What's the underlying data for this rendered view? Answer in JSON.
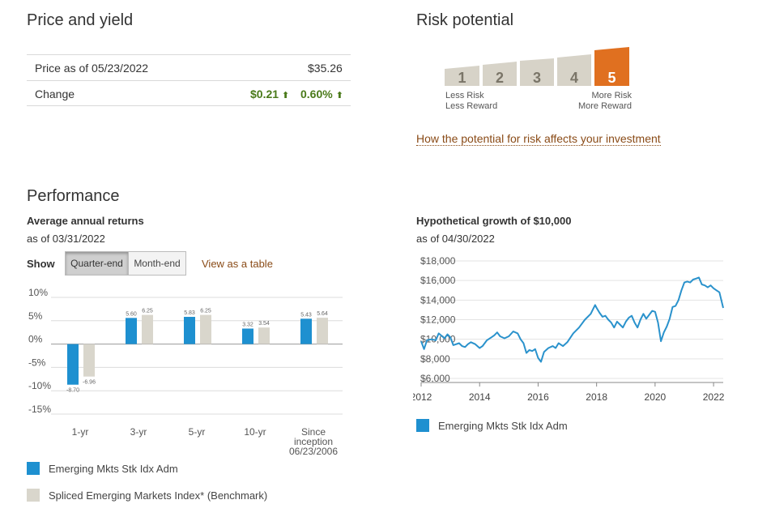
{
  "price_yield": {
    "title": "Price and yield",
    "price_label": "Price as of 05/23/2022",
    "price_value": "$35.26",
    "change_label": "Change",
    "change_amount": "$0.21",
    "change_pct": "0.60%",
    "up_icon": "arrow-up-icon"
  },
  "risk": {
    "title": "Risk potential",
    "levels": [
      "1",
      "2",
      "3",
      "4",
      "5"
    ],
    "selected_level": 5,
    "low_label_1": "Less Risk",
    "low_label_2": "Less Reward",
    "high_label_1": "More Risk",
    "high_label_2": "More Reward",
    "link": "How the potential for risk affects your investment",
    "colors": {
      "bar": "#d7d3c8",
      "selected": "#e07020"
    }
  },
  "performance": {
    "title": "Performance",
    "avg_title": "Average annual returns",
    "avg_asof": "as of 03/31/2022",
    "show_label": "Show",
    "tab_quarter": "Quarter-end",
    "tab_month": "Month-end",
    "table_link": "View as a table",
    "legend_fund": "Emerging Mkts Stk Idx Adm",
    "legend_bench": "Spliced Emerging Markets Index* (Benchmark)",
    "colors": {
      "fund": "#1e90d0",
      "bench": "#d9d6cc"
    }
  },
  "growth": {
    "title": "Hypothetical growth of $10,000",
    "asof": "as of 04/30/2022",
    "legend_fund": "Emerging Mkts Stk Idx Adm"
  },
  "chart_data": [
    {
      "type": "bar",
      "categories": [
        "1-yr",
        "3-yr",
        "5-yr",
        "10-yr",
        "Since inception 06/23/2006"
      ],
      "series": [
        {
          "name": "Emerging Mkts Stk Idx Adm",
          "values": [
            -8.7,
            5.6,
            5.83,
            3.32,
            5.43
          ]
        },
        {
          "name": "Spliced Emerging Markets Index* (Benchmark)",
          "values": [
            -6.96,
            6.25,
            6.25,
            3.54,
            5.64
          ]
        }
      ],
      "y_ticks": [
        "10%",
        "5%",
        "0%",
        "-5%",
        "-10%",
        "-15%"
      ],
      "ylim": [
        -15,
        10
      ]
    },
    {
      "type": "line",
      "x_ticks": [
        "2012",
        "2014",
        "2016",
        "2018",
        "2020",
        "2022"
      ],
      "y_ticks": [
        "$18,000",
        "$16,000",
        "$14,000",
        "$12,000",
        "$10,000",
        "$8,000",
        "$6,000"
      ],
      "ylim": [
        6000,
        18000
      ],
      "xlim": [
        2012,
        2022.33
      ],
      "series": [
        {
          "name": "Emerging Mkts Stk Idx Adm",
          "x": [
            2012.0,
            2012.1,
            2012.2,
            2012.35,
            2012.5,
            2012.6,
            2012.8,
            2012.9,
            2013.0,
            2013.1,
            2013.3,
            2013.4,
            2013.5,
            2013.6,
            2013.7,
            2013.85,
            2014.0,
            2014.1,
            2014.25,
            2014.4,
            2014.5,
            2014.6,
            2014.7,
            2014.85,
            2015.0,
            2015.15,
            2015.3,
            2015.4,
            2015.5,
            2015.6,
            2015.7,
            2015.8,
            2015.9,
            2016.0,
            2016.1,
            2016.2,
            2016.35,
            2016.5,
            2016.6,
            2016.7,
            2016.85,
            2017.0,
            2017.2,
            2017.4,
            2017.6,
            2017.8,
            2017.95,
            2018.0,
            2018.1,
            2018.2,
            2018.3,
            2018.4,
            2018.5,
            2018.6,
            2018.7,
            2018.8,
            2018.9,
            2019.0,
            2019.1,
            2019.2,
            2019.3,
            2019.4,
            2019.5,
            2019.6,
            2019.7,
            2019.8,
            2019.9,
            2020.0,
            2020.1,
            2020.2,
            2020.3,
            2020.4,
            2020.5,
            2020.6,
            2020.7,
            2020.8,
            2020.9,
            2021.0,
            2021.1,
            2021.2,
            2021.3,
            2021.4,
            2021.5,
            2021.6,
            2021.7,
            2021.8,
            2021.9,
            2022.0,
            2022.1,
            2022.2,
            2022.33
          ],
          "values": [
            9800,
            9000,
            9900,
            10000,
            9900,
            10600,
            10100,
            10500,
            10200,
            9400,
            9600,
            9300,
            9200,
            9500,
            9700,
            9500,
            9100,
            9300,
            9900,
            10200,
            10400,
            10700,
            10300,
            10100,
            10300,
            10800,
            10600,
            10000,
            9600,
            8600,
            8900,
            8800,
            9000,
            8100,
            7700,
            8700,
            9100,
            9300,
            9100,
            9600,
            9300,
            9700,
            10600,
            11200,
            12000,
            12600,
            13500,
            13200,
            12700,
            12300,
            12400,
            12000,
            11700,
            11200,
            11800,
            11500,
            11200,
            11800,
            12200,
            12400,
            11700,
            11200,
            12000,
            12600,
            12100,
            12500,
            12900,
            12800,
            11700,
            9800,
            10700,
            11300,
            12100,
            13300,
            13400,
            14000,
            15000,
            15800,
            15900,
            15800,
            16100,
            16200,
            16300,
            15600,
            15500,
            15300,
            15500,
            15200,
            15000,
            14800,
            13200
          ]
        }
      ]
    }
  ]
}
